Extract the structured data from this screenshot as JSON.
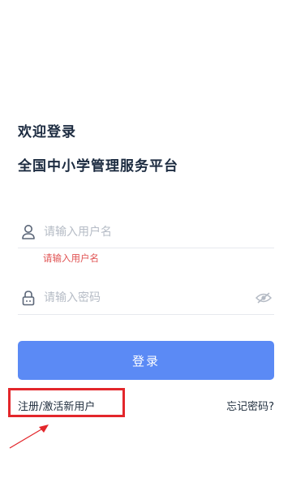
{
  "header": {
    "welcome": "欢迎登录",
    "platform_name": "全国中小学管理服务平台"
  },
  "form": {
    "username_placeholder": "请输入用户名",
    "username_error": "请输入用户名",
    "password_placeholder": "请输入密码",
    "login_label": "登录"
  },
  "links": {
    "register_activate": "注册/激活新用户",
    "forgot_password": "忘记密码?"
  },
  "colors": {
    "primary": "#5b8af5",
    "error": "#e05252",
    "highlight_box": "#e3262b"
  },
  "icons": {
    "user": "user-icon",
    "lock": "lock-icon",
    "eye": "eye-hidden-icon",
    "annotation": "arrow-icon"
  }
}
